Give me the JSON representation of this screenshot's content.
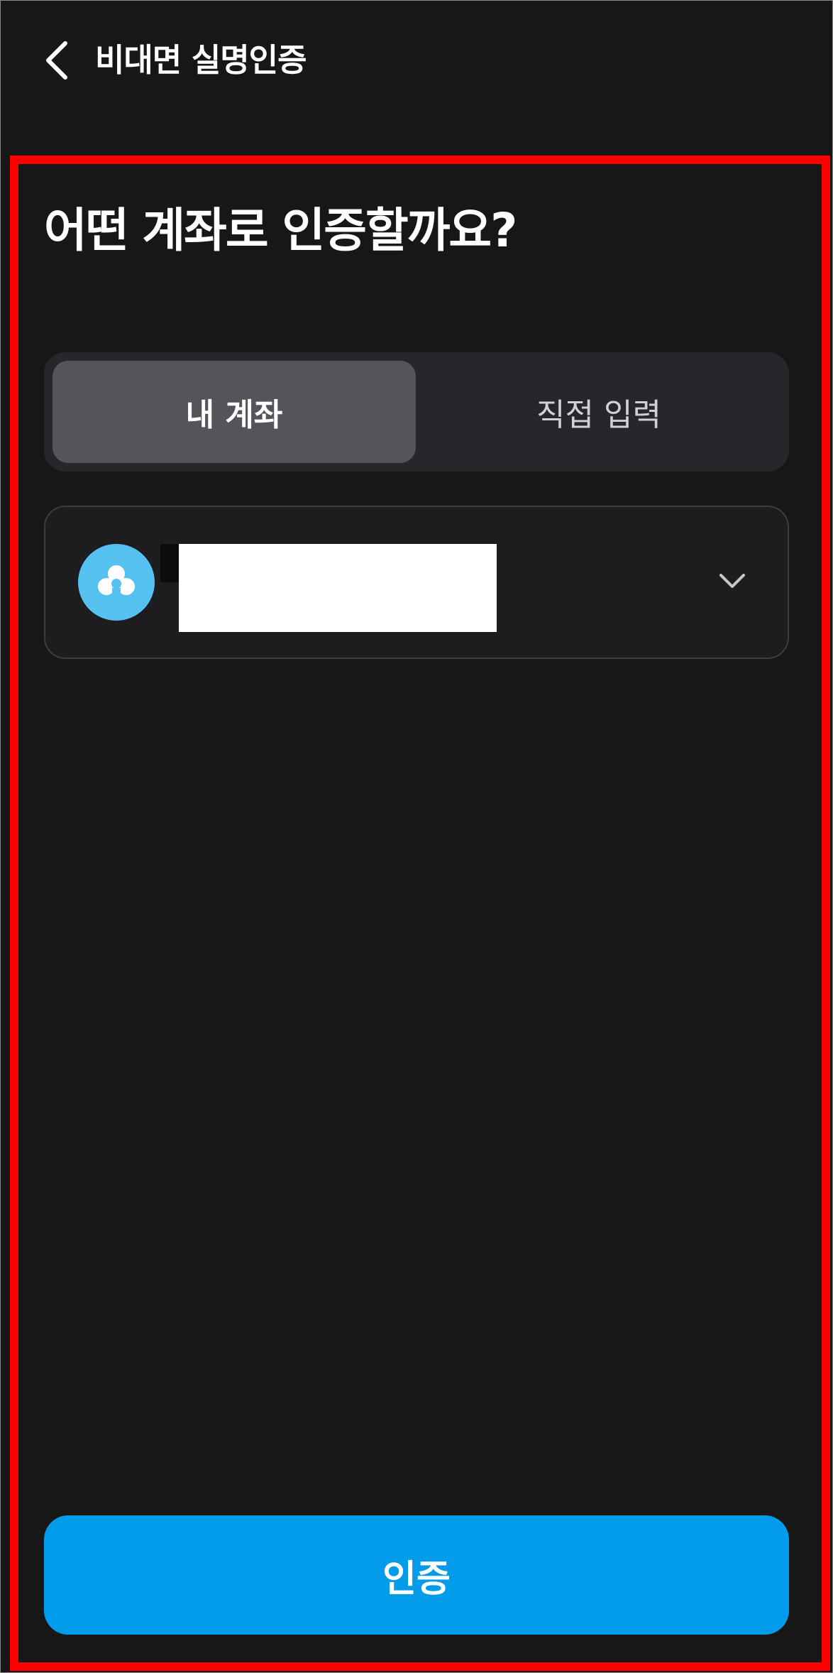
{
  "header": {
    "back_icon": "chevron-left-icon",
    "title": "비대면 실명인증"
  },
  "main": {
    "question": "어떤 계좌로 인증할까요?",
    "tabs": [
      {
        "label": "내 계좌",
        "selected": true
      },
      {
        "label": "직접 입력",
        "selected": false
      }
    ],
    "account_selector": {
      "bank_icon": "bank-logo-icon",
      "account_name": "",
      "dropdown_icon": "chevron-down-icon"
    },
    "confirm_label": "인증"
  },
  "colors": {
    "background": "#171718",
    "tab_active": "#53555b",
    "tab_track": "#26272b",
    "bank_logo": "#55c2f2",
    "confirm_button": "#029cea",
    "highlight_border": "#ff0000"
  }
}
